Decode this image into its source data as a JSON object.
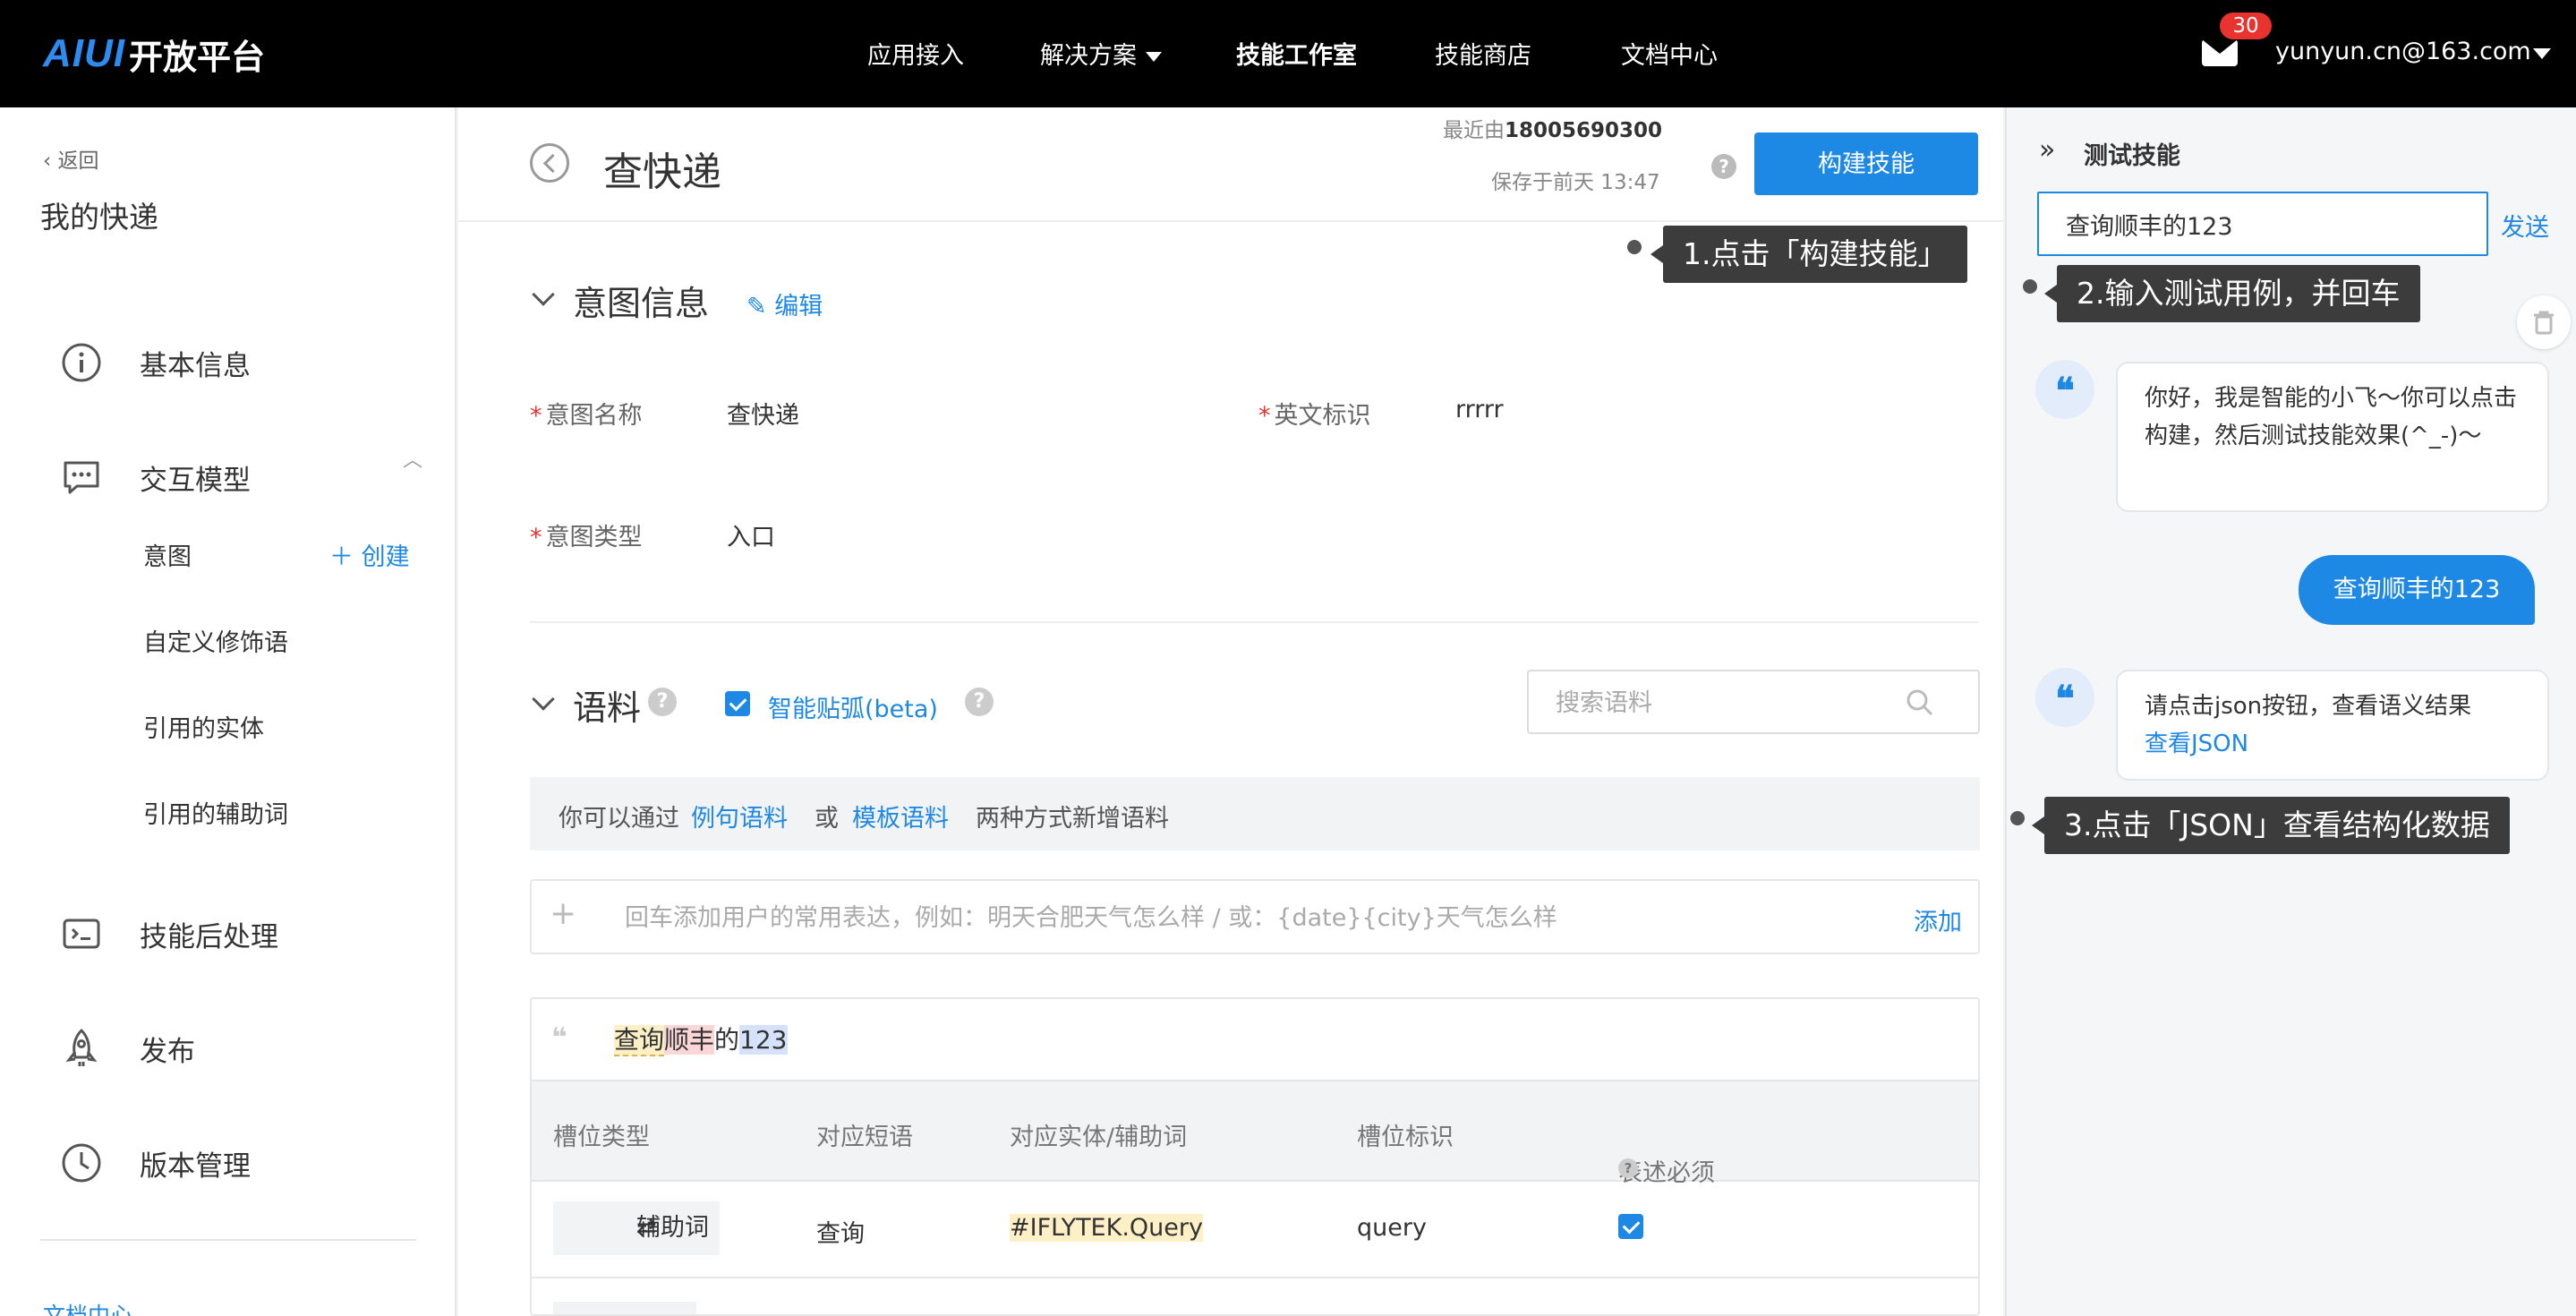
{
  "topbar": {
    "logo_mark": "AIUI",
    "logo_text": "开放平台",
    "nav": [
      {
        "label": "应用接入"
      },
      {
        "label": "解决方案"
      },
      {
        "label": "技能工作室"
      },
      {
        "label": "技能商店"
      },
      {
        "label": "文档中心"
      }
    ],
    "mail_badge": "30",
    "user_email": "yunyun.cn@163.com"
  },
  "sidebar": {
    "back": "返回",
    "title": "我的快递",
    "items": [
      {
        "label": "基本信息",
        "icon": "info-icon"
      },
      {
        "label": "交互模型",
        "icon": "chat-icon"
      },
      {
        "label": "技能后处理",
        "icon": "terminal-icon"
      },
      {
        "label": "发布",
        "icon": "rocket-icon"
      },
      {
        "label": "版本管理",
        "icon": "clock-icon"
      }
    ],
    "sub_items": [
      {
        "label": "意图"
      },
      {
        "label": "自定义修饰语"
      },
      {
        "label": "引用的实体"
      },
      {
        "label": "引用的辅助词"
      }
    ],
    "create_label": "创建",
    "doc_center": "文档中心"
  },
  "header": {
    "title": "查快递",
    "recent_prefix": "最近由",
    "recent_user": "18005690300",
    "saved_at": "保存于前天 13:47",
    "build_button": "构建技能"
  },
  "intent": {
    "section_title": "意图信息",
    "edit_label": "编辑",
    "name_label": "意图名称",
    "name_value": "查快递",
    "en_label": "英文标识",
    "en_value": "rrrrr",
    "type_label": "意图类型",
    "type_value": "入口"
  },
  "corpus": {
    "section_title": "语料",
    "smart_label": "智能贴弧(beta)",
    "search_placeholder": "搜索语料",
    "info_prefix": "你可以通过",
    "info_link1": "例句语料",
    "info_or": "或",
    "info_link2": "模板语料",
    "info_suffix": "两种方式新增语料",
    "add_placeholder": "回车添加用户的常用表达，例如：明天合肥天气怎么样 / 或：{date}{city}天气怎么样",
    "add_label": "添加",
    "sentence_segments": [
      "查询",
      "顺丰",
      "的",
      "123"
    ],
    "columns": [
      "槽位类型",
      "对应短语",
      "对应实体/辅助词",
      "槽位标识",
      "表述必须"
    ],
    "rows": [
      {
        "slot_type": "辅助词",
        "phrase": "查询",
        "entity": "#IFLYTEK.Query",
        "slot_id": "query",
        "required": true
      }
    ]
  },
  "test_panel": {
    "title": "测试技能",
    "input_value": "查询顺丰的123",
    "send_label": "发送",
    "bot_message_1": "你好，我是智能的小飞～你可以点击构建，然后测试技能效果(^_-)～",
    "user_message": "查询顺丰的123",
    "bot_message_2": "请点击json按钮，查看语义结果",
    "json_link": "查看JSON"
  },
  "callouts": [
    "1.点击「构建技能」",
    "2.输入测试用例，并回车",
    "3.点击「JSON」查看结构化数据"
  ],
  "colors": {
    "accent": "#1e88e5",
    "topbar": "#000000",
    "required": "#e8332f",
    "callout": "#3c3c3c"
  }
}
